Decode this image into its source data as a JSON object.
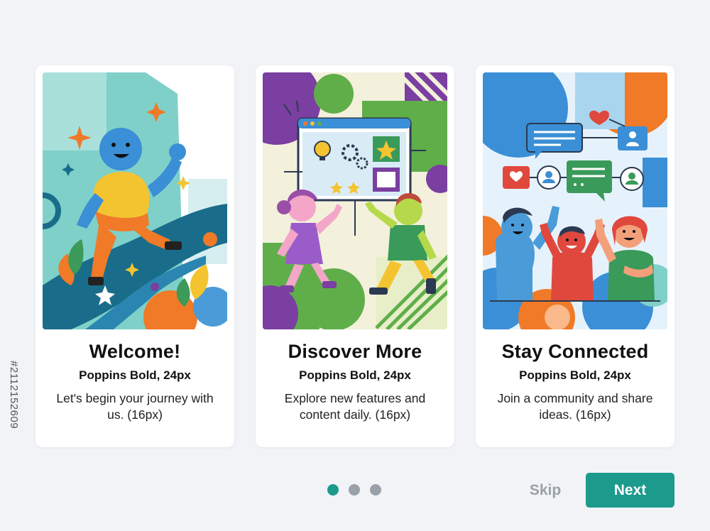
{
  "cards": [
    {
      "title": "Welcome!",
      "subtitle": "Poppins Bold, 24px",
      "body": "Let's begin your journey with us. (16px)"
    },
    {
      "title": "Discover More",
      "subtitle": "Poppins Bold, 24px",
      "body": "Explore new features and content daily. (16px)"
    },
    {
      "title": "Stay Connected",
      "subtitle": "Poppins Bold, 24px",
      "body": "Join a community and share ideas. (16px)"
    }
  ],
  "pagination": {
    "total": 3,
    "active_index": 0
  },
  "actions": {
    "skip_label": "Skip",
    "next_label": "Next"
  },
  "side_id": "#2112152609",
  "colors": {
    "accent": "#1c9a8c",
    "inactive": "#9aa0a8",
    "background": "#f1f3f6",
    "card": "#ffffff"
  }
}
